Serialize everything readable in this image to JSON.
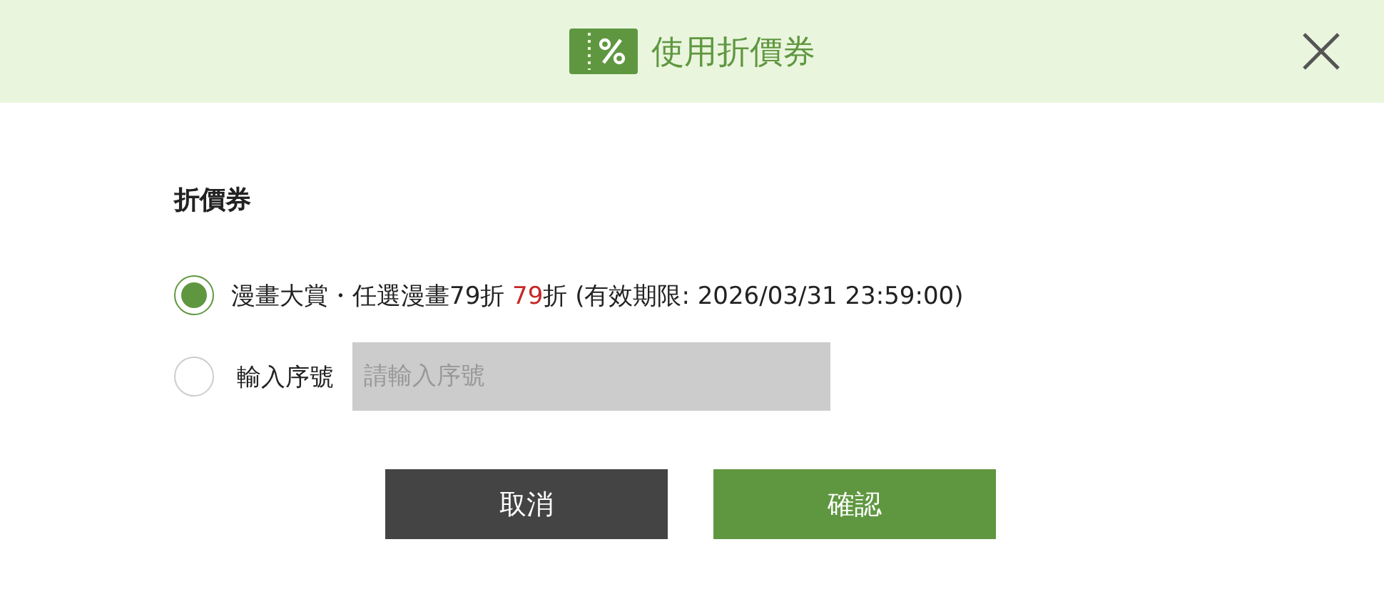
{
  "dialog": {
    "title": "使用折價券"
  },
  "section_title": "折價券",
  "options": [
    {
      "kind": "coupon",
      "selected": true,
      "segments": [
        {
          "text": "漫畫大賞・任選漫畫79折 ",
          "highlight": false
        },
        {
          "text": "79",
          "highlight": true
        },
        {
          "text": "折 (有效期限: 2026/03/31 23:59:00)",
          "highlight": false
        }
      ]
    },
    {
      "kind": "code",
      "selected": false,
      "label": "輸入序號",
      "placeholder": "請輸入序號"
    }
  ],
  "buttons": [
    {
      "kind": "cancel",
      "label": "取消"
    },
    {
      "kind": "confirm",
      "label": "確認"
    }
  ]
}
